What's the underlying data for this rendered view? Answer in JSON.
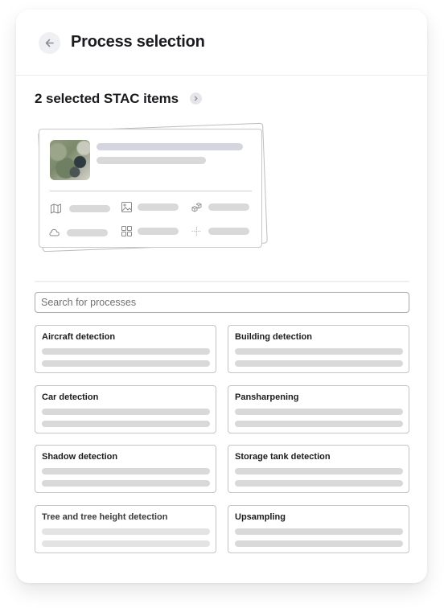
{
  "header": {
    "title": "Process selection",
    "back_icon": "arrow-left-icon"
  },
  "selection": {
    "title": "2 selected STAC items",
    "count": 2,
    "expand_icon": "chevron-right-icon",
    "preview_card": {
      "thumbnail": "satellite-image-thumbnail",
      "metadata_icons": [
        "map-icon",
        "image-icon",
        "cube-stack-icon",
        "cloud-icon",
        "grid-icon",
        "crosshair-icon"
      ]
    }
  },
  "search": {
    "placeholder": "Search for processes",
    "value": ""
  },
  "processes": [
    {
      "label": "Aircraft detection"
    },
    {
      "label": "Building detection"
    },
    {
      "label": "Car detection"
    },
    {
      "label": "Pansharpening"
    },
    {
      "label": "Shadow detection"
    },
    {
      "label": "Storage tank detection"
    },
    {
      "label": "Tree and tree height detection"
    },
    {
      "label": "Upsampling"
    }
  ],
  "colors": {
    "text": "#1b1b1f",
    "skeleton": "#d9d9d9",
    "skeleton_accent": "#d5d5e0",
    "border": "#c4c4c4",
    "button_bg": "#eff0f4"
  }
}
